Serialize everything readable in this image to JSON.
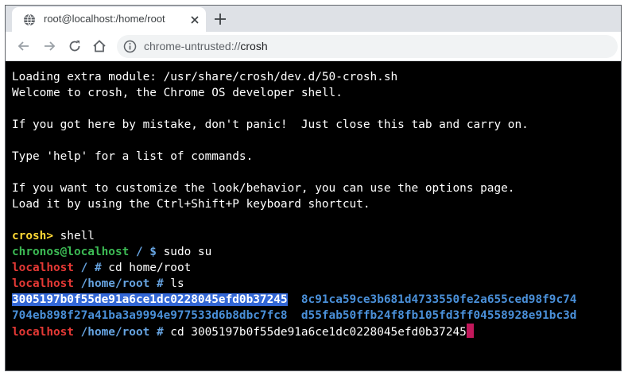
{
  "tab": {
    "title": "root@localhost:/home/root"
  },
  "toolbar": {
    "url_scheme": "chrome-untrusted://",
    "url_host": "crosh"
  },
  "icons": {
    "tab_favicon": "globe-icon",
    "tab_close": "close-icon",
    "new_tab": "plus-icon",
    "back": "arrow-left-icon",
    "forward": "arrow-right-icon",
    "reload": "reload-icon",
    "home": "home-icon",
    "site_info": "info-icon"
  },
  "colors": {
    "prompt_yellow": "#fdd835",
    "user_green": "#3cba54",
    "path_blue": "#66a3e0",
    "root_red": "#e53935",
    "dir_blue": "#4a90d9",
    "selection": "#3367d6",
    "cursor": "#c2185b"
  },
  "terminal": {
    "l1": "Loading extra module: /usr/share/crosh/dev.d/50-crosh.sh",
    "l2": "Welcome to crosh, the Chrome OS developer shell.",
    "l3": "If you got here by mistake, don't panic!  Just close this tab and carry on.",
    "l4": "Type 'help' for a list of commands.",
    "l5": "If you want to customize the look/behavior, you can use the options page.",
    "l6": "Load it by using the Ctrl+Shift+P keyboard shortcut.",
    "crosh_prompt": "crosh>",
    "crosh_cmd": " shell",
    "chronos_user": "chronos@localhost",
    "chronos_path": " / $",
    "chronos_cmd": " sudo su",
    "root_host": "localhost",
    "root_path_1": " / #",
    "root_cmd_1": " cd home/root",
    "root_path_2": " /home/root #",
    "root_cmd_2": " ls",
    "dir_1": "3005197b0f55de91a6ce1dc0228045efd0b37245",
    "dir_2": "8c91ca59ce3b681d4733550fe2a655ced98f9c74",
    "dir_3": "704eb898f27a41ba3a9994e977533d6b8dbc7fc8",
    "dir_4": "d55fab50ffb24f8fb105fd3ff04558928e91bc3d",
    "root_path_3": " /home/root #",
    "root_cmd_3": " cd 3005197b0f55de91a6ce1dc0228045efd0b37245"
  }
}
